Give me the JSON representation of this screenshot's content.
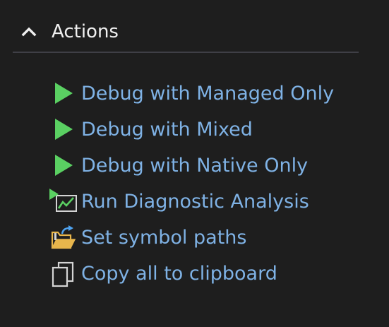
{
  "section": {
    "title": "Actions",
    "expanded": true,
    "chevron_icon": "chevron-up-icon"
  },
  "actions": [
    {
      "label": "Debug with Managed Only",
      "icon": "play-icon"
    },
    {
      "label": "Debug with Mixed",
      "icon": "play-icon"
    },
    {
      "label": "Debug with Native Only",
      "icon": "play-icon"
    },
    {
      "label": "Run Diagnostic Analysis",
      "icon": "diagnostic-chart-icon"
    },
    {
      "label": "Set symbol paths",
      "icon": "folder-arrow-icon"
    },
    {
      "label": "Copy all to clipboard",
      "icon": "copy-icon"
    }
  ],
  "colors": {
    "background": "#1e1e1e",
    "header_text": "#f0f0f0",
    "link_text": "#7fb2e5",
    "play_green": "#5ad062",
    "folder_yellow": "#e8b64c",
    "divider": "#3f3f46"
  }
}
